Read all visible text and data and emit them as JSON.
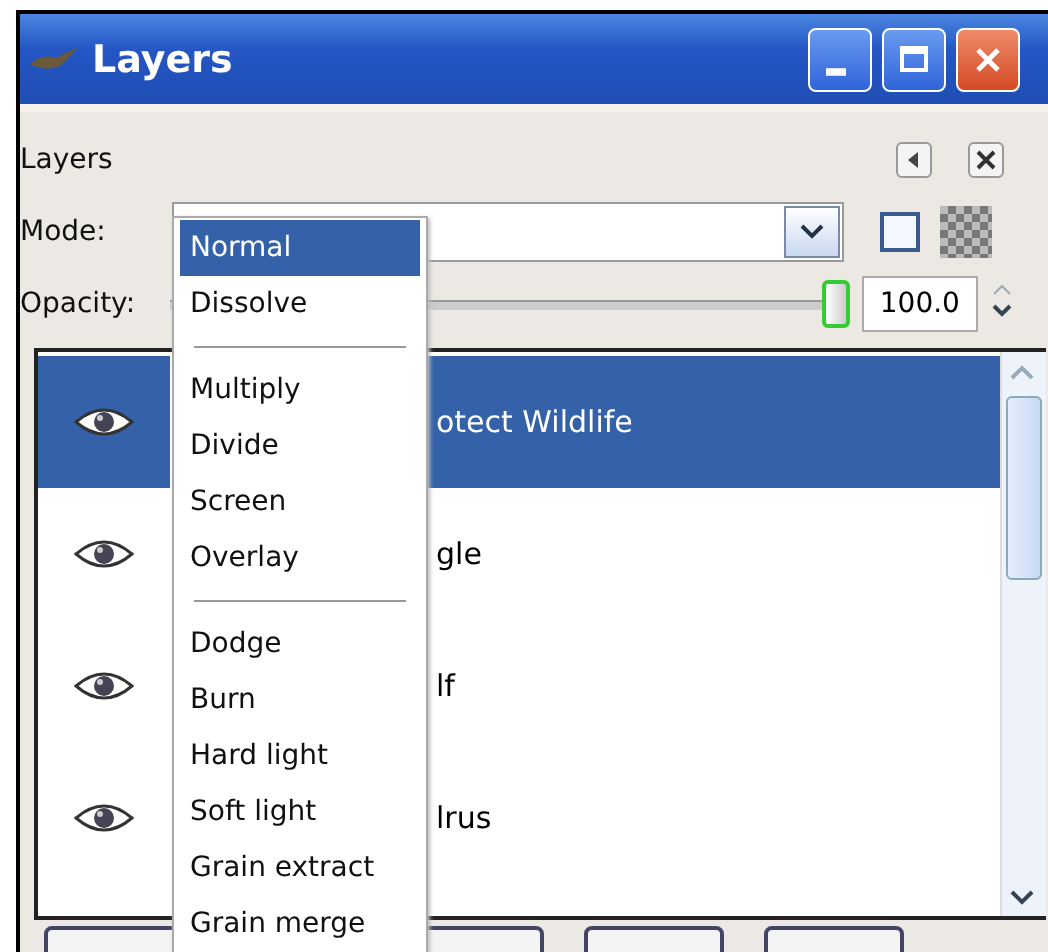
{
  "window": {
    "title": "Layers"
  },
  "panel": {
    "title": "Layers"
  },
  "mode": {
    "label": "Mode:"
  },
  "lock": {
    "checked": false
  },
  "opacity": {
    "label": "Opacity:",
    "level": 1.0,
    "value": "100.0"
  },
  "layers": [
    {
      "name": "otect Wildlife",
      "selected": true
    },
    {
      "name": "gle",
      "selected": false
    },
    {
      "name": "lf",
      "selected": false
    },
    {
      "name": "lrus",
      "selected": false
    }
  ],
  "mode_menu": [
    {
      "kind": "item",
      "label": "Normal",
      "selected": true
    },
    {
      "kind": "item",
      "label": "Dissolve",
      "selected": false
    },
    {
      "kind": "separator"
    },
    {
      "kind": "item",
      "label": "Multiply",
      "selected": false
    },
    {
      "kind": "item",
      "label": "Divide",
      "selected": false
    },
    {
      "kind": "item",
      "label": "Screen",
      "selected": false
    },
    {
      "kind": "item",
      "label": "Overlay",
      "selected": false
    },
    {
      "kind": "separator"
    },
    {
      "kind": "item",
      "label": "Dodge",
      "selected": false
    },
    {
      "kind": "item",
      "label": "Burn",
      "selected": false
    },
    {
      "kind": "item",
      "label": "Hard light",
      "selected": false
    },
    {
      "kind": "item",
      "label": "Soft light",
      "selected": false
    },
    {
      "kind": "item",
      "label": "Grain extract",
      "selected": false
    },
    {
      "kind": "item",
      "label": "Grain merge",
      "selected": false
    }
  ]
}
